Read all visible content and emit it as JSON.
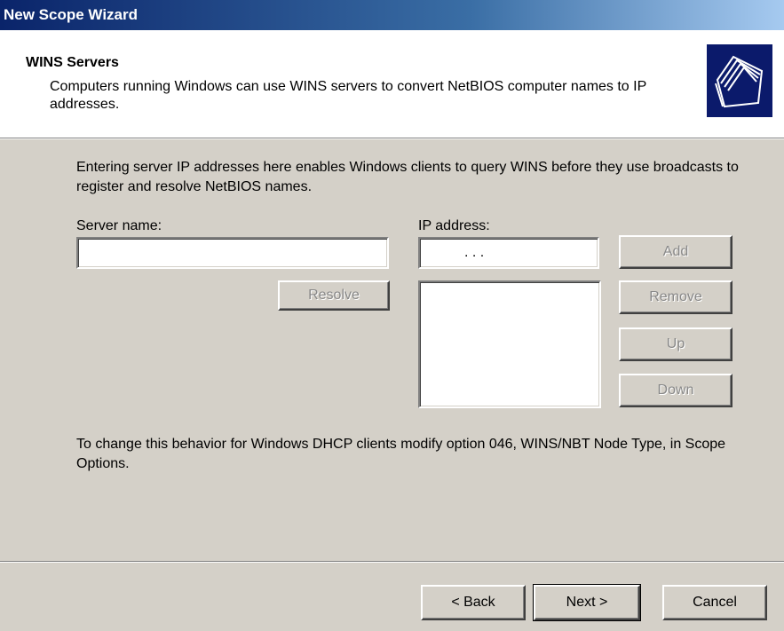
{
  "window": {
    "title": "New Scope Wizard"
  },
  "header": {
    "title": "WINS Servers",
    "description": "Computers running Windows can use WINS servers to convert NetBIOS computer names to IP addresses.",
    "icon": "folders-icon"
  },
  "body": {
    "intro": "Entering server IP addresses here enables Windows clients to query WINS before they use broadcasts to register and resolve NetBIOS names.",
    "server_name_label": "Server name:",
    "server_name_value": "",
    "ip_address_label": "IP address:",
    "ip_address_value": ".      .      .",
    "resolve_label": "Resolve",
    "add_label": "Add",
    "remove_label": "Remove",
    "up_label": "Up",
    "down_label": "Down",
    "ip_list": [],
    "note": "To change this behavior for Windows DHCP clients modify option 046, WINS/NBT Node Type, in Scope Options."
  },
  "footer": {
    "back_label": "< Back",
    "next_label": "Next >",
    "cancel_label": "Cancel"
  },
  "colors": {
    "title_bar": "#0a246a",
    "face": "#d4d0c8",
    "disabled_text": "#888888"
  }
}
